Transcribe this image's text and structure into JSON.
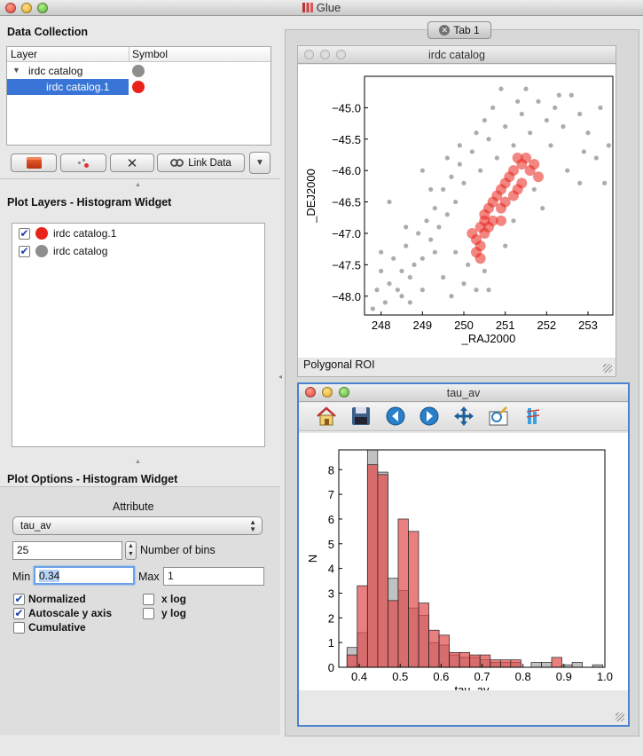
{
  "window": {
    "title": "Glue"
  },
  "data_collection": {
    "heading": "Data Collection",
    "columns": [
      "Layer",
      "Symbol"
    ],
    "rows": [
      {
        "label": "irdc catalog",
        "color": "#8e8e8e"
      },
      {
        "label": "irdc catalog.1",
        "color": "#e8231a",
        "selected": true
      }
    ],
    "buttons": {
      "link_data": "Link Data"
    }
  },
  "plot_layers": {
    "heading": "Plot Layers - Histogram Widget",
    "items": [
      {
        "label": "irdc catalog.1",
        "color": "#e8231a",
        "checked": true
      },
      {
        "label": "irdc catalog",
        "color": "#8e8e8e",
        "checked": true
      }
    ]
  },
  "plot_options": {
    "heading": "Plot Options - Histogram Widget",
    "attribute_label": "Attribute",
    "attribute_value": "tau_av",
    "bins_value": "25",
    "bins_label": "Number of bins",
    "min_label": "Min",
    "min_value": "0.34",
    "max_label": "Max",
    "max_value": "1",
    "checks": {
      "normalized": "Normalized",
      "autoscale": "Autoscale y axis",
      "cumulative": "Cumulative",
      "xlog": "x log",
      "ylog": "y log"
    }
  },
  "tabs": [
    {
      "label": "Tab 1"
    }
  ],
  "scatter_window": {
    "title": "irdc catalog",
    "status": "Polygonal ROI"
  },
  "hist_window": {
    "title": "tau_av"
  },
  "chart_data": [
    {
      "type": "scatter",
      "xlabel": "_RAJ2000",
      "ylabel": "_DEJ2000",
      "xlim": [
        247.6,
        253.6
      ],
      "ylim": [
        -48.3,
        -44.5
      ],
      "xticks": [
        248,
        249,
        250,
        251,
        252,
        253
      ],
      "yticks": [
        -45.0,
        -45.5,
        -46.0,
        -46.5,
        -47.0,
        -47.5,
        -48.0
      ],
      "series": [
        {
          "color": "#909090",
          "values": [
            [
              247.8,
              -48.2
            ],
            [
              247.9,
              -47.9
            ],
            [
              248.0,
              -47.6
            ],
            [
              248.1,
              -48.1
            ],
            [
              248.2,
              -47.8
            ],
            [
              248.3,
              -47.4
            ],
            [
              248.4,
              -47.9
            ],
            [
              248.5,
              -47.6
            ],
            [
              248.6,
              -47.2
            ],
            [
              248.7,
              -47.7
            ],
            [
              248.8,
              -47.5
            ],
            [
              248.9,
              -47.0
            ],
            [
              249.0,
              -47.4
            ],
            [
              249.1,
              -46.8
            ],
            [
              249.2,
              -47.1
            ],
            [
              249.3,
              -46.6
            ],
            [
              249.4,
              -46.9
            ],
            [
              249.5,
              -46.3
            ],
            [
              249.6,
              -46.7
            ],
            [
              249.7,
              -46.1
            ],
            [
              249.8,
              -46.5
            ],
            [
              249.9,
              -45.9
            ],
            [
              250.0,
              -46.2
            ],
            [
              250.2,
              -45.7
            ],
            [
              250.4,
              -46.0
            ],
            [
              250.6,
              -45.5
            ],
            [
              250.8,
              -45.8
            ],
            [
              251.0,
              -45.3
            ],
            [
              251.2,
              -45.6
            ],
            [
              251.4,
              -45.1
            ],
            [
              251.6,
              -45.4
            ],
            [
              251.8,
              -44.9
            ],
            [
              252.0,
              -45.2
            ],
            [
              252.2,
              -45.0
            ],
            [
              252.4,
              -45.3
            ],
            [
              252.6,
              -44.8
            ],
            [
              252.8,
              -45.1
            ],
            [
              253.0,
              -45.4
            ],
            [
              253.3,
              -45.0
            ],
            [
              253.5,
              -45.6
            ],
            [
              248.5,
              -48.0
            ],
            [
              249.0,
              -47.9
            ],
            [
              249.5,
              -47.7
            ],
            [
              249.8,
              -47.3
            ],
            [
              250.0,
              -47.8
            ],
            [
              250.5,
              -47.6
            ],
            [
              250.1,
              -47.5
            ],
            [
              249.3,
              -47.3
            ],
            [
              248.2,
              -46.5
            ],
            [
              249.0,
              -46.0
            ],
            [
              249.6,
              -45.8
            ],
            [
              250.5,
              -45.2
            ],
            [
              250.9,
              -44.7
            ],
            [
              251.3,
              -44.9
            ],
            [
              252.1,
              -45.6
            ],
            [
              252.5,
              -46.0
            ],
            [
              252.8,
              -46.2
            ],
            [
              253.2,
              -45.8
            ],
            [
              251.7,
              -46.3
            ],
            [
              251.2,
              -46.8
            ],
            [
              248.7,
              -48.1
            ],
            [
              249.7,
              -48.0
            ],
            [
              250.3,
              -47.9
            ],
            [
              248.0,
              -47.3
            ],
            [
              248.6,
              -46.9
            ],
            [
              249.2,
              -46.3
            ],
            [
              249.9,
              -45.6
            ],
            [
              250.3,
              -45.4
            ],
            [
              250.7,
              -45.0
            ],
            [
              251.5,
              -44.7
            ],
            [
              252.3,
              -44.8
            ],
            [
              252.9,
              -45.7
            ],
            [
              253.4,
              -46.2
            ],
            [
              251.9,
              -46.6
            ],
            [
              251.0,
              -47.2
            ],
            [
              250.6,
              -47.9
            ]
          ]
        },
        {
          "color": "#e8231a",
          "values": [
            [
              250.3,
              -47.3
            ],
            [
              250.3,
              -47.1
            ],
            [
              250.4,
              -46.9
            ],
            [
              250.4,
              -47.2
            ],
            [
              250.5,
              -46.8
            ],
            [
              250.6,
              -46.6
            ],
            [
              250.5,
              -47.0
            ],
            [
              250.7,
              -46.5
            ],
            [
              250.8,
              -46.4
            ],
            [
              250.9,
              -46.3
            ],
            [
              250.9,
              -46.6
            ],
            [
              251.0,
              -46.2
            ],
            [
              251.1,
              -46.1
            ],
            [
              251.2,
              -46.0
            ],
            [
              251.3,
              -46.3
            ],
            [
              251.4,
              -45.9
            ],
            [
              251.5,
              -45.8
            ],
            [
              251.6,
              -46.0
            ],
            [
              251.7,
              -45.9
            ],
            [
              251.4,
              -46.2
            ],
            [
              251.2,
              -46.4
            ],
            [
              250.9,
              -46.8
            ],
            [
              250.6,
              -46.9
            ],
            [
              250.4,
              -47.4
            ],
            [
              251.8,
              -46.1
            ],
            [
              251.0,
              -46.5
            ],
            [
              250.7,
              -46.8
            ],
            [
              251.3,
              -45.8
            ],
            [
              250.5,
              -46.7
            ],
            [
              250.2,
              -47.0
            ]
          ]
        }
      ]
    },
    {
      "type": "bar",
      "xlabel": "tau_av",
      "ylabel": "N",
      "xlim": [
        0.35,
        1.0
      ],
      "ylim": [
        0,
        8.8
      ],
      "xticks": [
        0.4,
        0.5,
        0.6,
        0.7,
        0.8,
        0.9,
        1.0
      ],
      "yticks": [
        0,
        1,
        2,
        3,
        4,
        5,
        6,
        7,
        8
      ],
      "bin_edges": [
        0.37,
        0.395,
        0.42,
        0.445,
        0.47,
        0.495,
        0.52,
        0.545,
        0.57,
        0.595,
        0.62,
        0.645,
        0.67,
        0.695,
        0.72,
        0.745,
        0.77,
        0.795,
        0.82,
        0.845,
        0.87,
        0.895,
        0.92,
        0.945,
        0.97,
        0.995
      ],
      "series": [
        {
          "color": "#8e8e8e",
          "values": [
            0.8,
            1.4,
            8.9,
            7.9,
            3.6,
            3.1,
            2.4,
            2.1,
            1.0,
            0.9,
            0.5,
            0.4,
            0.4,
            0.3,
            0.2,
            0.2,
            0.2,
            0.0,
            0.2,
            0.2,
            0.0,
            0.1,
            0.2,
            0.0,
            0.1
          ]
        },
        {
          "color": "#e04848",
          "values": [
            0.5,
            3.3,
            8.2,
            7.8,
            2.7,
            6.0,
            5.5,
            2.6,
            1.5,
            1.3,
            0.6,
            0.6,
            0.5,
            0.5,
            0.3,
            0.3,
            0.3,
            0.0,
            0.0,
            0.0,
            0.4,
            0.0,
            0.0,
            0.0,
            0.0
          ]
        }
      ]
    }
  ]
}
